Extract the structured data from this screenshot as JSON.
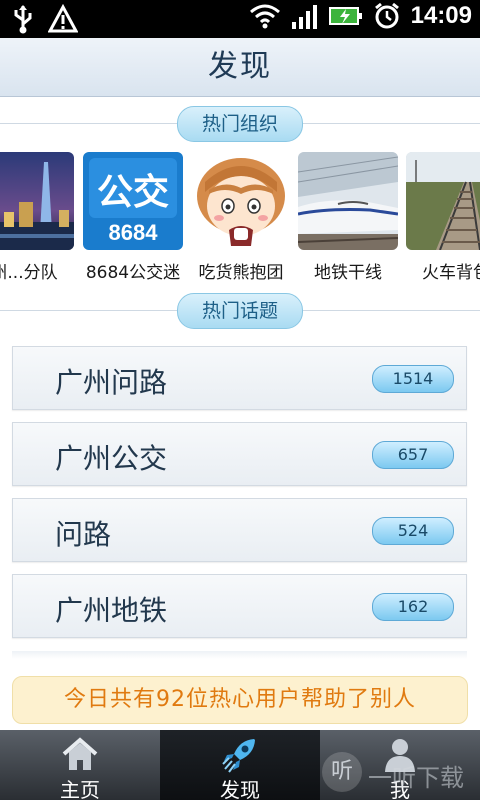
{
  "status_bar": {
    "time": "14:09",
    "icons": [
      "usb-icon",
      "warning-icon",
      "wifi-icon",
      "signal-icon",
      "battery-charging-icon",
      "alarm-icon"
    ]
  },
  "header": {
    "title": "发现"
  },
  "sections": {
    "hot_orgs": "热门组织",
    "hot_topics": "热门话题"
  },
  "orgs": [
    {
      "label": "州...分队"
    },
    {
      "label": "8684公交迷",
      "logo_text": "公交",
      "logo_sub": "8684"
    },
    {
      "label": "吃货熊抱团"
    },
    {
      "label": "地铁干线"
    },
    {
      "label": "火车背包"
    }
  ],
  "topics": [
    {
      "label": "广州问路",
      "count": "1514"
    },
    {
      "label": "广州公交",
      "count": "657"
    },
    {
      "label": "问路",
      "count": "524"
    },
    {
      "label": "广州地铁",
      "count": "162"
    }
  ],
  "banner": {
    "text": "今日共有92位热心用户帮助了别人"
  },
  "bottom_nav": [
    {
      "label": "主页",
      "icon": "home-icon",
      "active": false
    },
    {
      "label": "发现",
      "icon": "rocket-icon",
      "active": true
    },
    {
      "label": "我",
      "icon": "person-icon",
      "active": false
    }
  ],
  "watermark": {
    "glyph": "听",
    "text": "一听下载"
  },
  "colors": {
    "accent": "#1d5f87",
    "banner_text": "#e07a10",
    "badge": "#7cc9f0"
  }
}
